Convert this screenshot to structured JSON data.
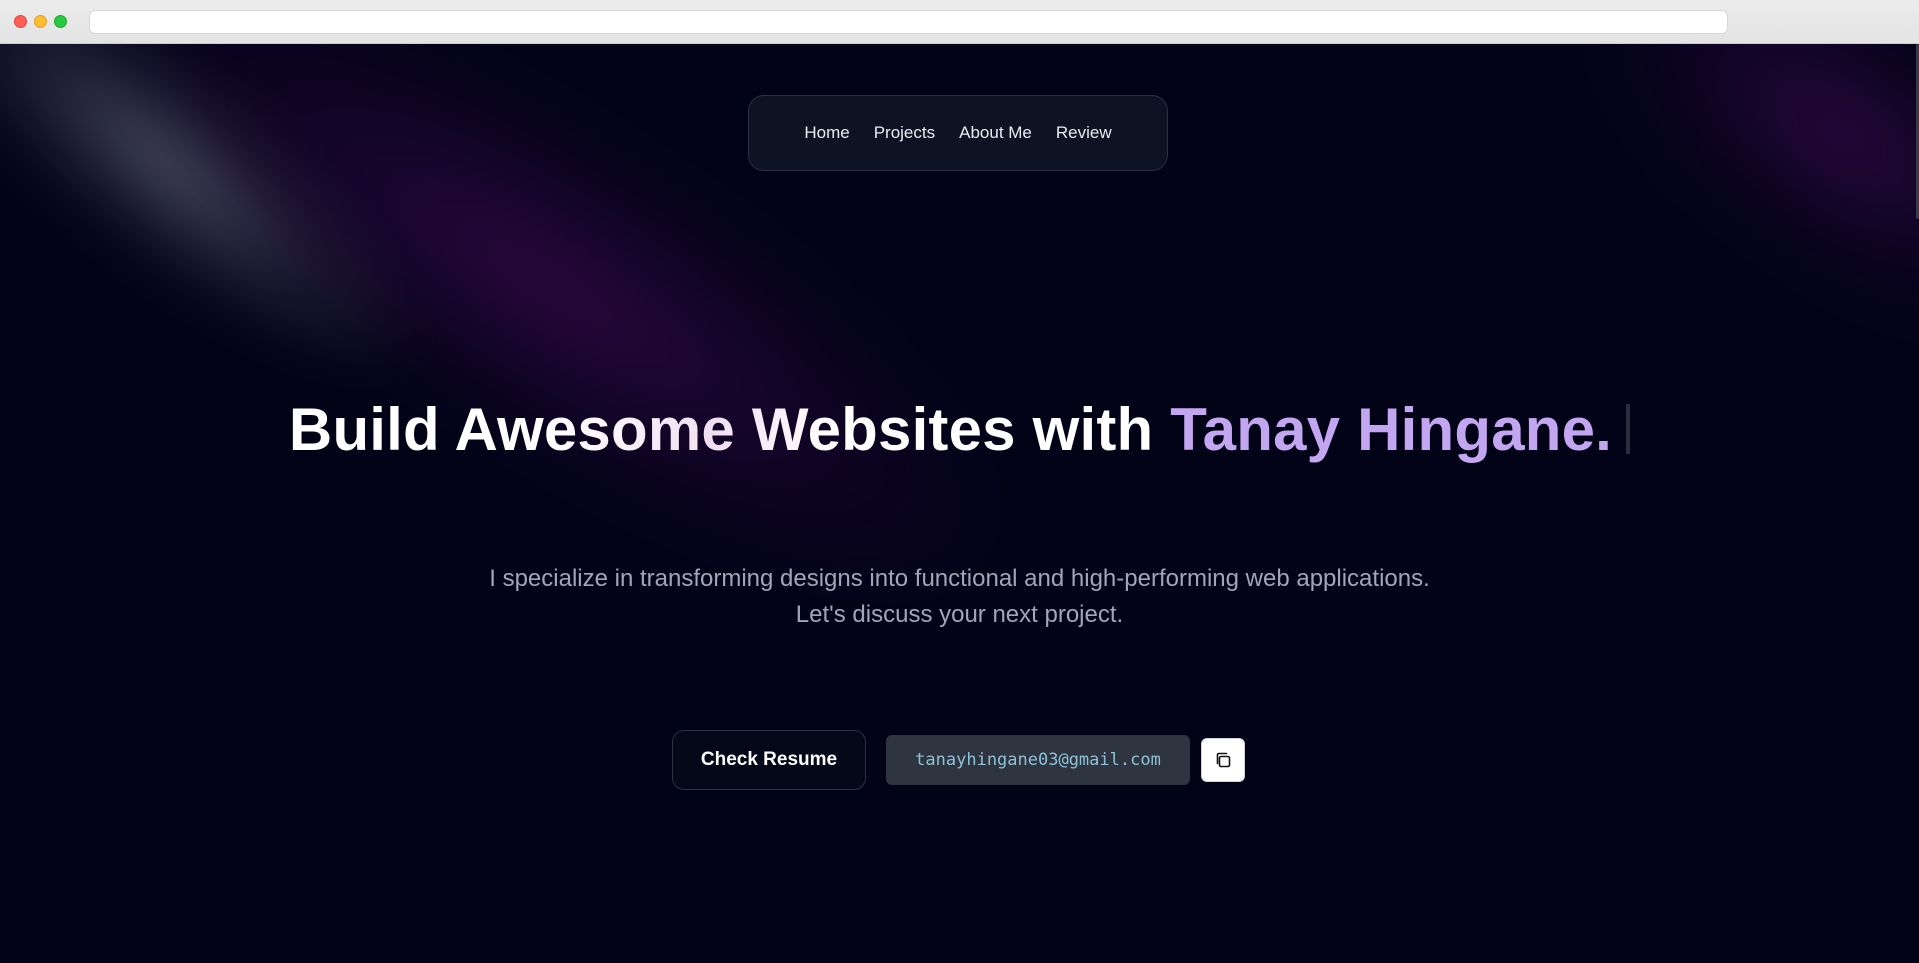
{
  "nav": {
    "items": [
      {
        "label": "Home"
      },
      {
        "label": "Projects"
      },
      {
        "label": "About Me"
      },
      {
        "label": "Review"
      }
    ]
  },
  "hero": {
    "headline_plain": "Build Awesome Websites with ",
    "headline_accent": "Tanay Hingane.",
    "subtext_line1": "I specialize in transforming designs into functional and high-performing web applications.",
    "subtext_line2": "Let's discuss your next project."
  },
  "actions": {
    "resume_label": "Check Resume",
    "email": "tanayhingane03@gmail.com",
    "copy_icon": "copy-icon"
  },
  "colors": {
    "background": "#030318",
    "accent": "#c3a6f0",
    "email_text": "#8ec2d6",
    "email_chip": "#2e3440"
  }
}
